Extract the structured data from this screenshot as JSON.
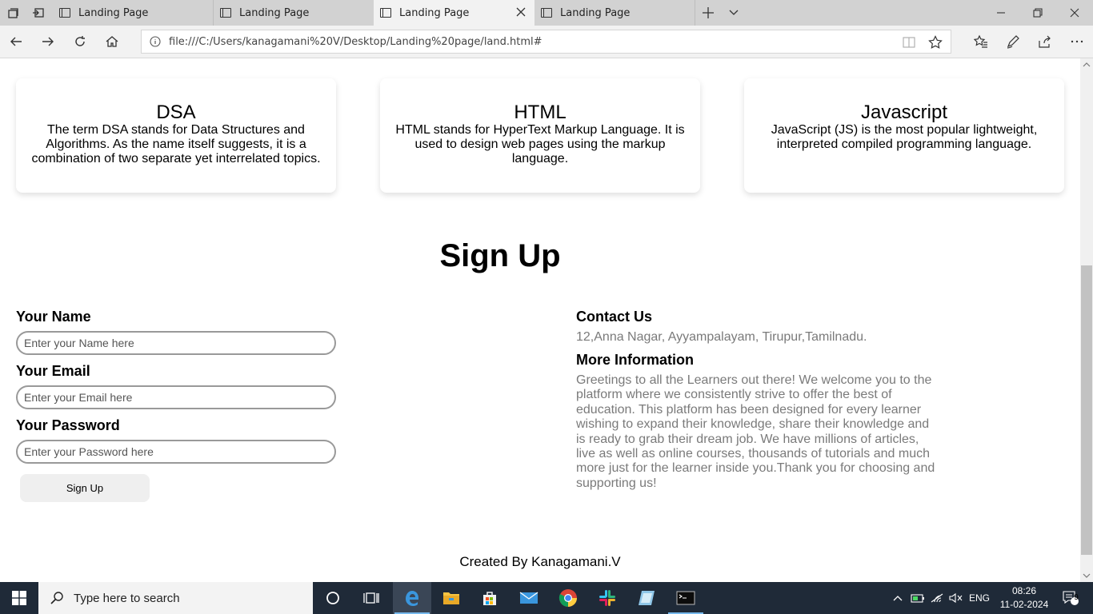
{
  "browser": {
    "tabs": [
      {
        "title": "Landing Page"
      },
      {
        "title": "Landing Page"
      },
      {
        "title": "Landing Page"
      },
      {
        "title": "Landing Page"
      }
    ],
    "url": "file:///C:/Users/kanagamani%20V/Desktop/Landing%20page/land.html#"
  },
  "cards": [
    {
      "title": "DSA",
      "text": "The term DSA stands for Data Structures and Algorithms. As the name itself suggests, it is a combination of two separate yet interrelated topics."
    },
    {
      "title": "HTML",
      "text": "HTML stands for HyperText Markup Language. It is used to design web pages using the markup language."
    },
    {
      "title": "Javascript",
      "text": "JavaScript (JS) is the most popular lightweight, interpreted compiled programming language."
    }
  ],
  "signup": {
    "title": "Sign Up",
    "name_label": "Your Name",
    "name_placeholder": "Enter your Name here",
    "email_label": "Your Email",
    "email_placeholder": "Enter your Email here",
    "password_label": "Your Password",
    "password_placeholder": "Enter your Password here",
    "button": "Sign Up"
  },
  "contact": {
    "heading": "Contact Us",
    "address": "12,Anna Nagar, Ayyampalayam, Tirupur,Tamilnadu.",
    "more_heading": "More Information",
    "more_text": "Greetings to all the Learners out there! We welcome you to the platform where we consistently strive to offer the best of education. This platform has been designed for every learner wishing to expand their knowledge, share their knowledge and is ready to grab their dream job. We have millions of articles, live as well as online courses, thousands of tutorials and much more just for the learner inside you.Thank you for choosing and supporting us!"
  },
  "footer": "Created By Kanagamani.V",
  "taskbar": {
    "search_placeholder": "Type here to search",
    "language": "ENG",
    "time": "08:26",
    "date": "11-02-2024",
    "notification_count": "9"
  }
}
